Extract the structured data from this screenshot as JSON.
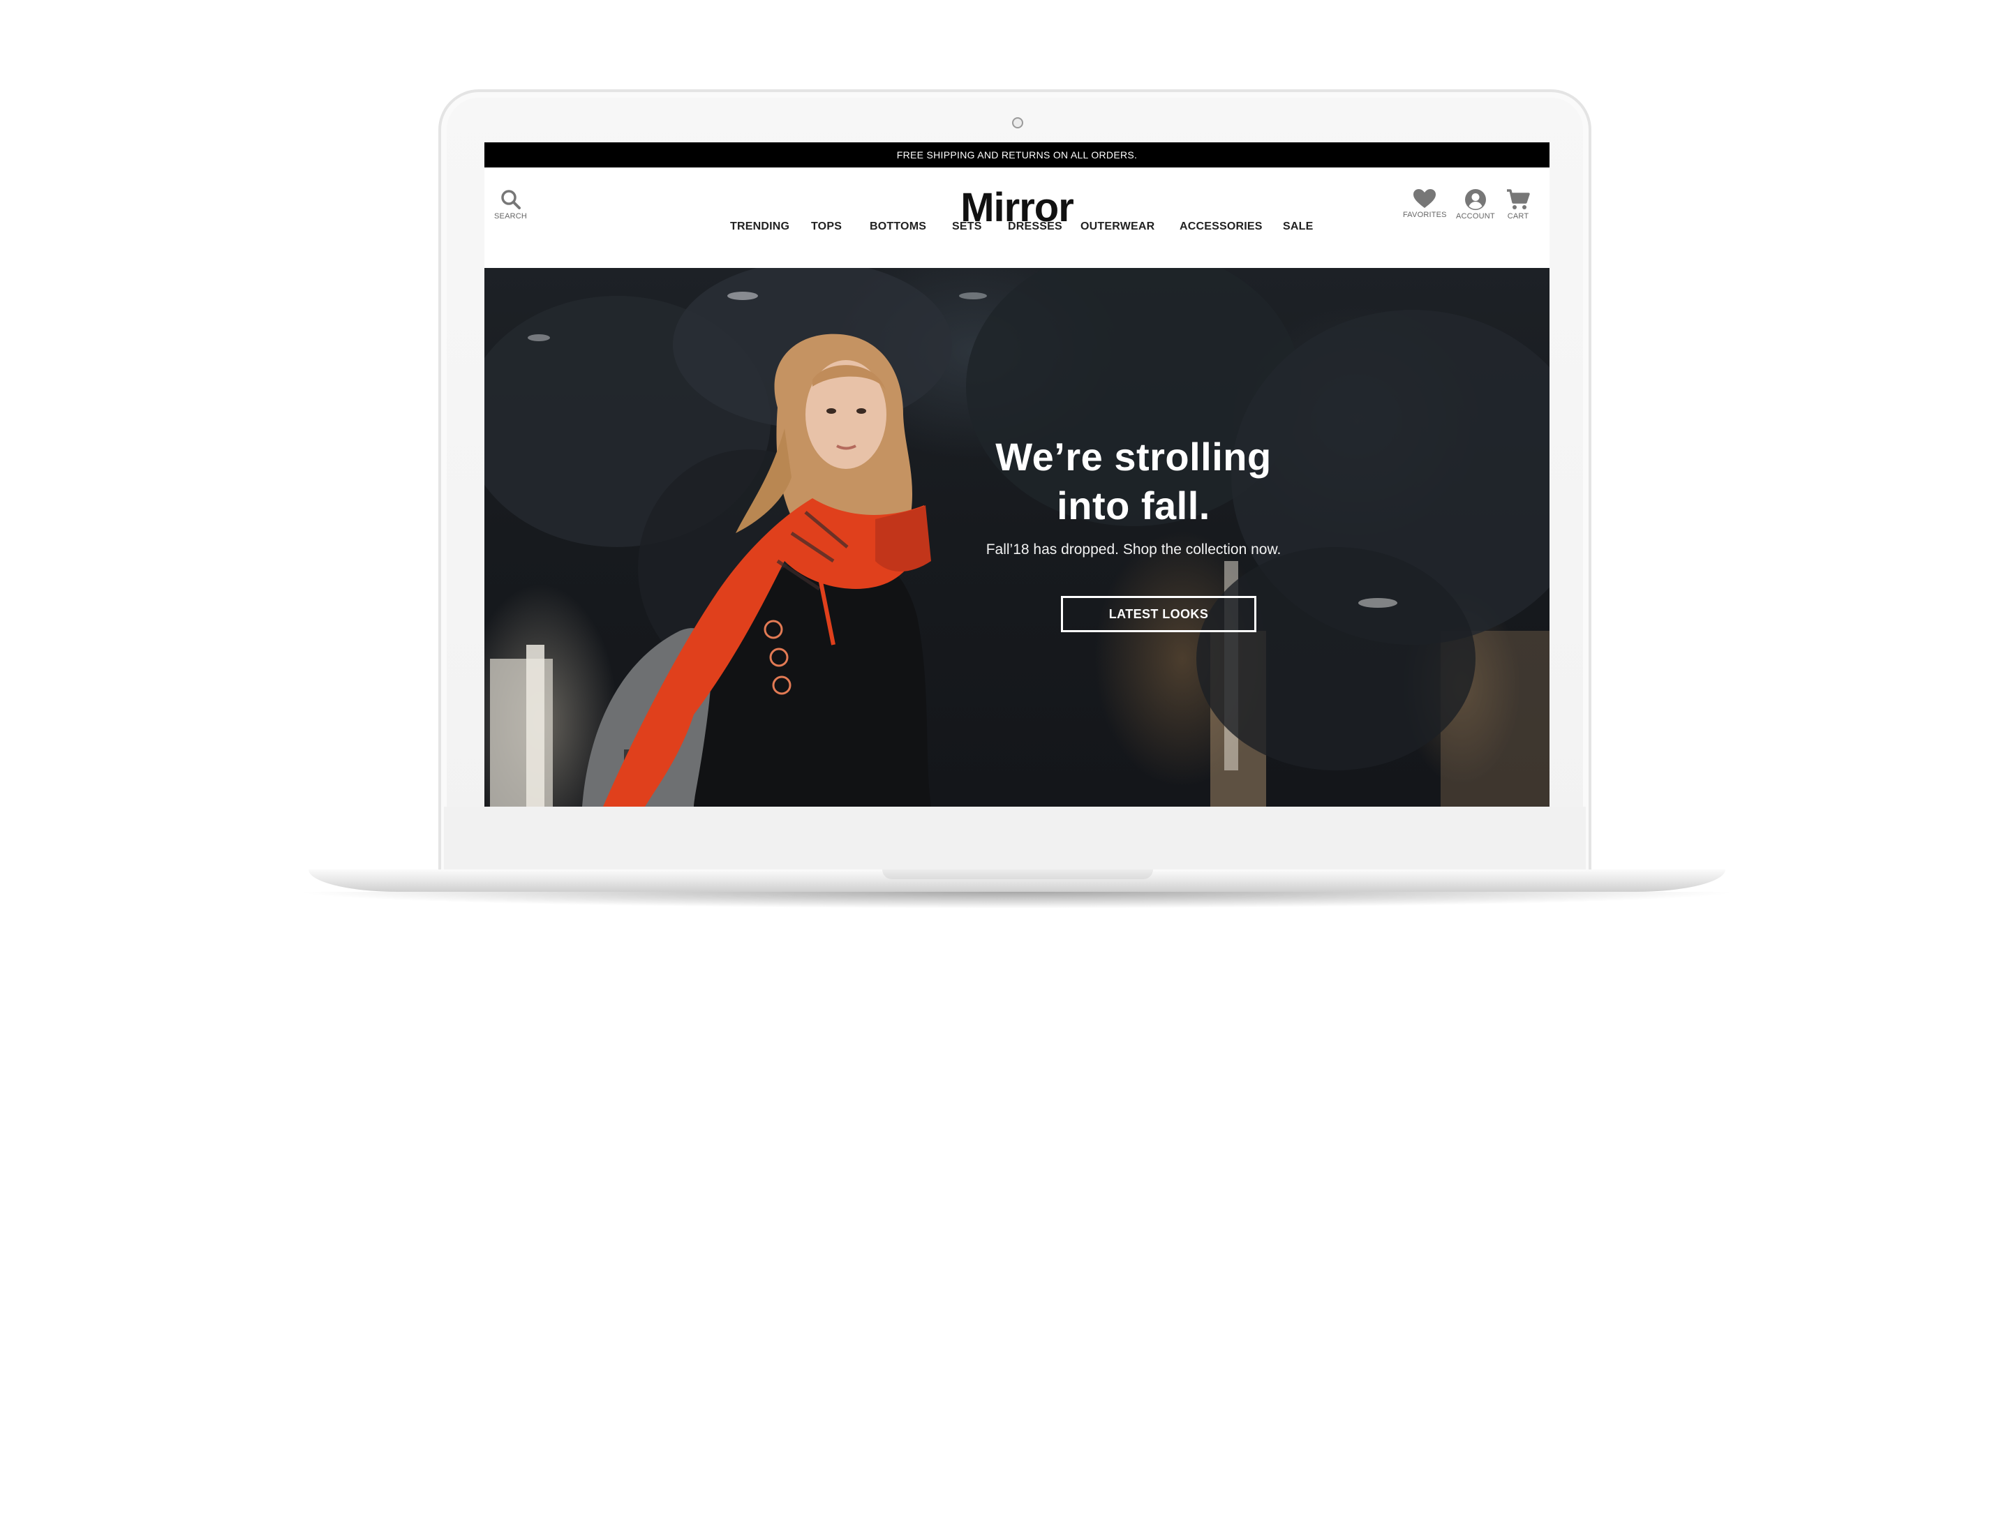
{
  "promo": {
    "text": "FREE SHIPPING AND RETURNS ON ALL ORDERS."
  },
  "header": {
    "logo": "Mirror",
    "search_label": "SEARCH",
    "favorites_label": "FAVORITES",
    "account_label": "ACCOUNT",
    "cart_label": "CART"
  },
  "nav": {
    "items": [
      {
        "label": "TRENDING"
      },
      {
        "label": "TOPS"
      },
      {
        "label": "BOTTOMS"
      },
      {
        "label": "SETS"
      },
      {
        "label": "DRESSES"
      },
      {
        "label": "OUTERWEAR"
      },
      {
        "label": "ACCESSORIES"
      },
      {
        "label": "SALE"
      }
    ]
  },
  "hero": {
    "title_line1": "We’re strolling",
    "title_line2": "into fall.",
    "subtitle": "Fall’18 has dropped. Shop the collection now.",
    "cta_label": "LATEST LOOKS"
  },
  "colors": {
    "promo_bg": "#000000",
    "nav_text": "#222222",
    "icon_gray": "#777777",
    "scarf_orange": "#e0401c",
    "hero_text": "#ffffff"
  },
  "icons": [
    "search-icon",
    "heart-icon",
    "account-icon",
    "cart-icon",
    "camera-icon"
  ]
}
